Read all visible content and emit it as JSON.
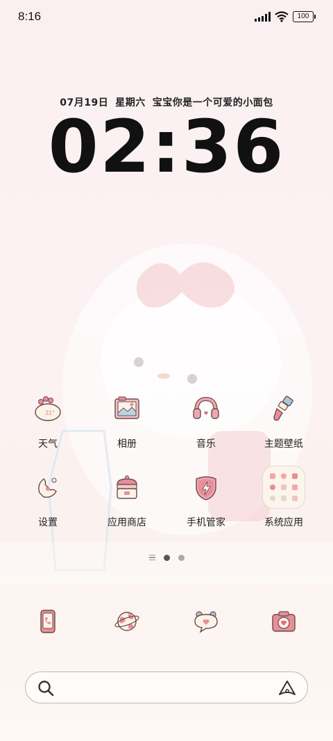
{
  "status_bar": {
    "time": "8:16",
    "battery": "100",
    "icons": [
      "signal-icon",
      "wifi-icon",
      "battery-icon"
    ]
  },
  "clock_widget": {
    "date": "07月19日",
    "weekday": "星期六",
    "motto": "宝宝你是一个可爱的小面包",
    "time": "02:36"
  },
  "apps": [
    {
      "label": "天气",
      "icon": "weather-icon",
      "temp": "31°"
    },
    {
      "label": "相册",
      "icon": "gallery-icon"
    },
    {
      "label": "音乐",
      "icon": "headphones-icon"
    },
    {
      "label": "主题壁纸",
      "icon": "paintbrush-icon"
    },
    {
      "label": "设置",
      "icon": "settings-icon"
    },
    {
      "label": "应用商店",
      "icon": "app-store-icon"
    },
    {
      "label": "手机管家",
      "icon": "phone-manager-icon"
    },
    {
      "label": "系统应用",
      "icon": "folder-icon"
    }
  ],
  "page_indicator": {
    "current": 2,
    "total": 2
  },
  "dock": [
    {
      "icon": "phone-icon"
    },
    {
      "icon": "browser-icon"
    },
    {
      "icon": "messages-icon"
    },
    {
      "icon": "camera-icon"
    }
  ],
  "search": {
    "placeholder": ""
  },
  "colors": {
    "accent_pink": "#e88e9a",
    "outline": "#6b4b4b",
    "cream": "#fbf3e6"
  }
}
